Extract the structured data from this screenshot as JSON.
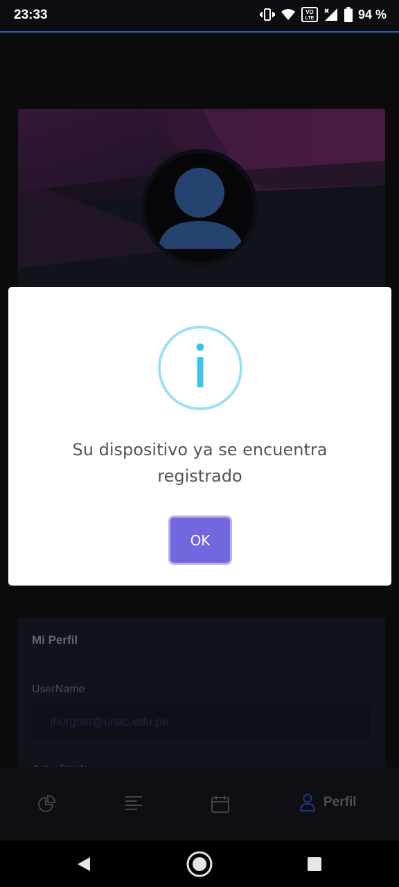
{
  "status_bar": {
    "time": "23:33",
    "battery": "94 %",
    "icons": [
      "vibrate-icon",
      "wifi-icon",
      "volte-icon",
      "signal-icon",
      "battery-icon"
    ]
  },
  "profile_card": {
    "title": "Mi Perfil",
    "username_label": "UserName",
    "username_value": "jburgost@unac.edu.pe",
    "updated_label": "Actualizado"
  },
  "bottom_nav": {
    "items": [
      {
        "icon": "chart-pie-icon",
        "label": ""
      },
      {
        "icon": "list-icon",
        "label": ""
      },
      {
        "icon": "calendar-icon",
        "label": ""
      },
      {
        "icon": "user-icon",
        "label": "Perfil"
      }
    ]
  },
  "dialog": {
    "icon": "info-icon",
    "message": "Su dispositivo ya se encuentra registrado",
    "ok_label": "OK"
  },
  "colors": {
    "accent": "#7367e0",
    "info": "#3fc3ee",
    "active_nav": "#3558c8"
  }
}
